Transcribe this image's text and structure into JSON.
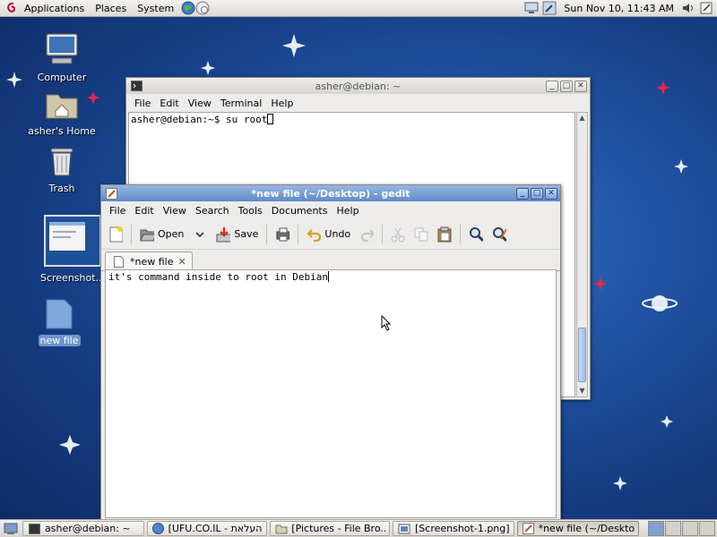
{
  "top_panel": {
    "menus": [
      "Applications",
      "Places",
      "System"
    ],
    "clock": "Sun Nov 10, 11:43 AM"
  },
  "desktop": {
    "icons": [
      {
        "label": "Computer"
      },
      {
        "label": "asher's Home"
      },
      {
        "label": "Trash"
      },
      {
        "label": "Screenshot..."
      },
      {
        "label": "new file"
      }
    ]
  },
  "terminal": {
    "title": "asher@debian: ~",
    "menu": [
      "File",
      "Edit",
      "View",
      "Terminal",
      "Help"
    ],
    "prompt_line": "asher@debian:~$ su root"
  },
  "gedit": {
    "title": "*new file (~/Desktop) - gedit",
    "menu": [
      "File",
      "Edit",
      "View",
      "Search",
      "Tools",
      "Documents",
      "Help"
    ],
    "toolbar": {
      "open_label": "Open",
      "save_label": "Save",
      "undo_label": "Undo"
    },
    "tab_label": "*new file",
    "content": "it's command inside to root in Debian"
  },
  "taskbar": {
    "tasks": [
      {
        "label": "asher@debian: ~",
        "icon": "terminal-icon"
      },
      {
        "label": "[UFU.CO.IL - העלאת...",
        "icon": "browser-icon"
      },
      {
        "label": "[Pictures - File Bro...",
        "icon": "folder-icon"
      },
      {
        "label": "[Screenshot-1.png]",
        "icon": "image-icon"
      },
      {
        "label": "*new file (~/Deskto...",
        "icon": "gedit-icon"
      }
    ]
  }
}
